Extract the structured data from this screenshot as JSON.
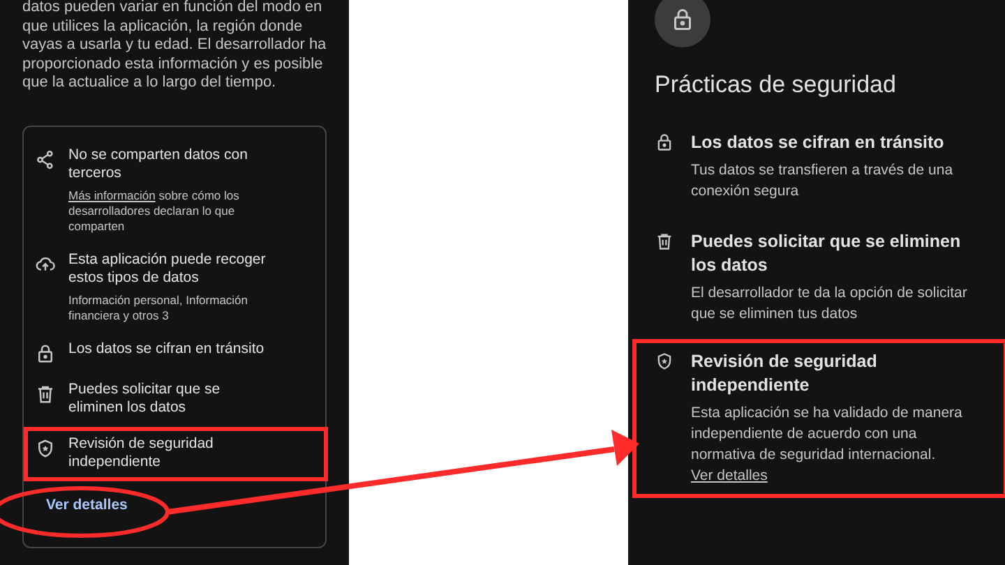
{
  "left_screen": {
    "intro": "datos pueden variar en función del modo en que utilices la aplicación, la región donde vayas a usarla y tu edad. El desarrollador ha proporcionado esta información y es posible que la actualice a lo largo del tiempo.",
    "card": {
      "items": [
        {
          "kind": "share",
          "title": "No se comparten datos con terceros",
          "description": [
            {
              "kind": "link",
              "text": "Más información"
            },
            {
              "kind": "text",
              "text": " sobre cómo los desarrolladores declaran lo que comparten"
            }
          ],
          "highlighted": false
        },
        {
          "kind": "cloud-upload",
          "title": "Esta aplicación puede recoger estos tipos de datos",
          "description": [
            {
              "kind": "text",
              "text": "Información personal, Información financiera y otros 3"
            }
          ],
          "highlighted": false
        },
        {
          "kind": "lock",
          "title": "Los datos se cifran en tránsito",
          "highlighted": false
        },
        {
          "kind": "trash",
          "title": "Puedes solicitar que se eliminen los datos",
          "highlighted": false
        },
        {
          "kind": "shield",
          "title": "Revisión de seguridad independiente",
          "highlighted": true
        }
      ],
      "link": "Ver detalles"
    }
  },
  "right_screen": {
    "title": "Prácticas de seguridad",
    "items": [
      {
        "kind": "lock",
        "title": "Los datos se cifran en tránsito",
        "description": [
          {
            "kind": "text",
            "text": "Tus datos se transfieren a través de una conexión segura"
          }
        ],
        "highlighted": false
      },
      {
        "kind": "trash",
        "title": "Puedes solicitar que se eliminen los datos",
        "description": [
          {
            "kind": "text",
            "text": "El desarrollador te da la opción de solicitar que se eliminen tus datos"
          }
        ],
        "highlighted": false
      },
      {
        "kind": "shield",
        "title": "Revisión de seguridad independiente",
        "description": [
          {
            "kind": "text",
            "text": "Esta aplicación se ha validado de manera independiente de acuerdo con una normativa de seguridad internacional. "
          },
          {
            "kind": "link",
            "text": "Ver detalles"
          }
        ],
        "highlighted": true
      }
    ]
  }
}
